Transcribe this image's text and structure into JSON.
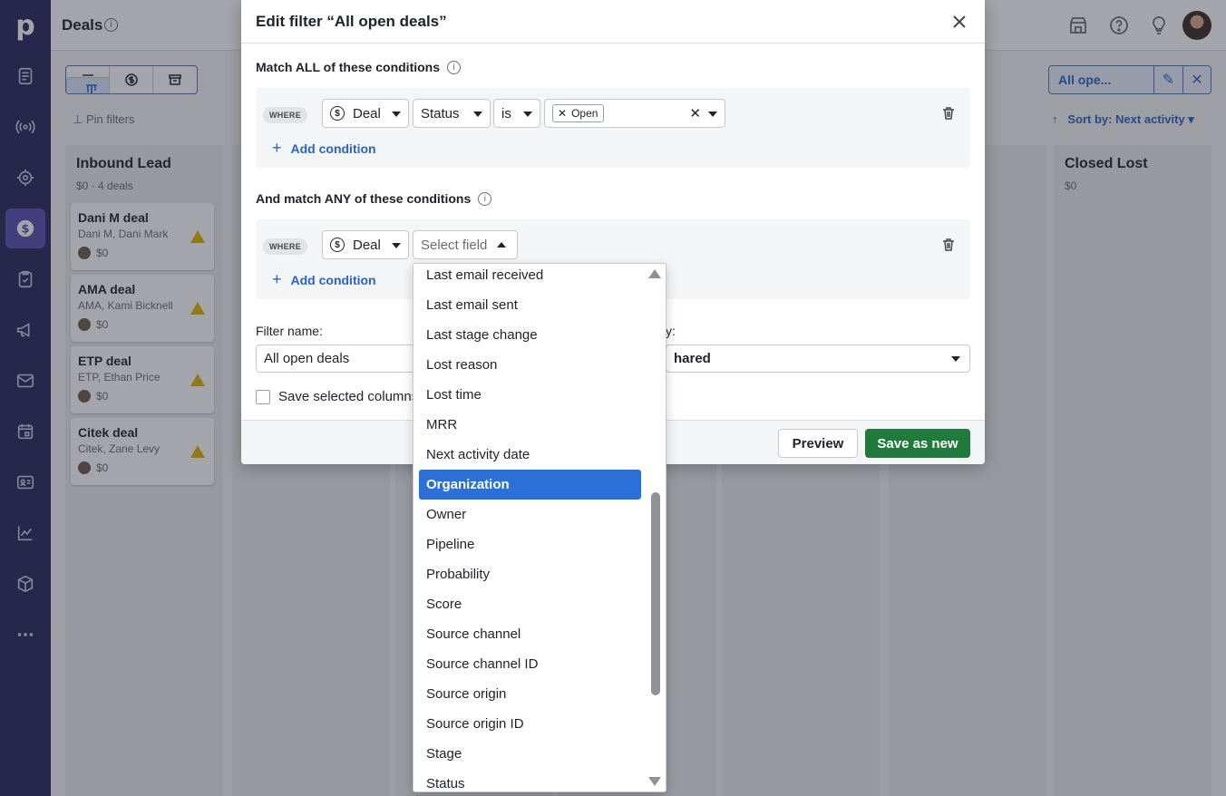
{
  "app": {
    "logo": "p",
    "page_title": "Deals",
    "nav_icons": [
      "leads-icon",
      "radio-icon",
      "target-icon",
      "deals-icon",
      "tasks-icon",
      "campaign-icon",
      "mail-icon",
      "calendar-icon",
      "contacts-icon",
      "insights-icon",
      "products-icon",
      "more-icon"
    ]
  },
  "toolbar": {
    "pin_filters": "Pin filters",
    "filter_label": "All ope...",
    "sort_label": "Sort by: Next activity"
  },
  "pipeline": {
    "columns": [
      {
        "name": "Inbound Lead",
        "summary": "$0 · 4 deals"
      },
      {
        "name": "Closed Lost",
        "summary": "$0"
      }
    ],
    "cards": [
      {
        "title": "Dani M deal",
        "people": "Dani M, Dani Mark",
        "value": "$0"
      },
      {
        "title": "AMA deal",
        "people": "AMA, Kami Bicknell",
        "value": "$0"
      },
      {
        "title": "ETP deal",
        "people": "ETP, Ethan Price",
        "value": "$0"
      },
      {
        "title": "Citek deal",
        "people": "Citek, Zane Levy",
        "value": "$0"
      }
    ]
  },
  "modal": {
    "title": "Edit filter “All open deals”",
    "match_all_title": "Match ALL of these conditions",
    "match_any_title": "And match ANY of these conditions",
    "where_label": "WHERE",
    "all_condition": {
      "entity": "Deal",
      "field": "Status",
      "operator": "is",
      "value_tag": "Open"
    },
    "any_condition": {
      "entity": "Deal",
      "field_placeholder": "Select field"
    },
    "add_condition": "Add condition",
    "filter_name_label": "Filter name:",
    "filter_name_value": "All open deals",
    "visibility_label": "y:",
    "visibility_value": "hared",
    "save_columns_label": "Save selected columns",
    "preview_button": "Preview",
    "save_button": "Save as new"
  },
  "dropdown": {
    "highlighted": "Organization",
    "items": [
      "Last email received",
      "Last email sent",
      "Last stage change",
      "Lost reason",
      "Lost time",
      "MRR",
      "Next activity date",
      "Organization",
      "Owner",
      "Pipeline",
      "Probability",
      "Score",
      "Source channel",
      "Source channel ID",
      "Source origin",
      "Source origin ID",
      "Stage",
      "Status"
    ]
  },
  "colors": {
    "nav_bg": "#26265c",
    "accent_blue": "#2a63c4",
    "highlight": "#2b6fd8",
    "save_green": "#1f7a3b",
    "warning": "#e2b100"
  }
}
